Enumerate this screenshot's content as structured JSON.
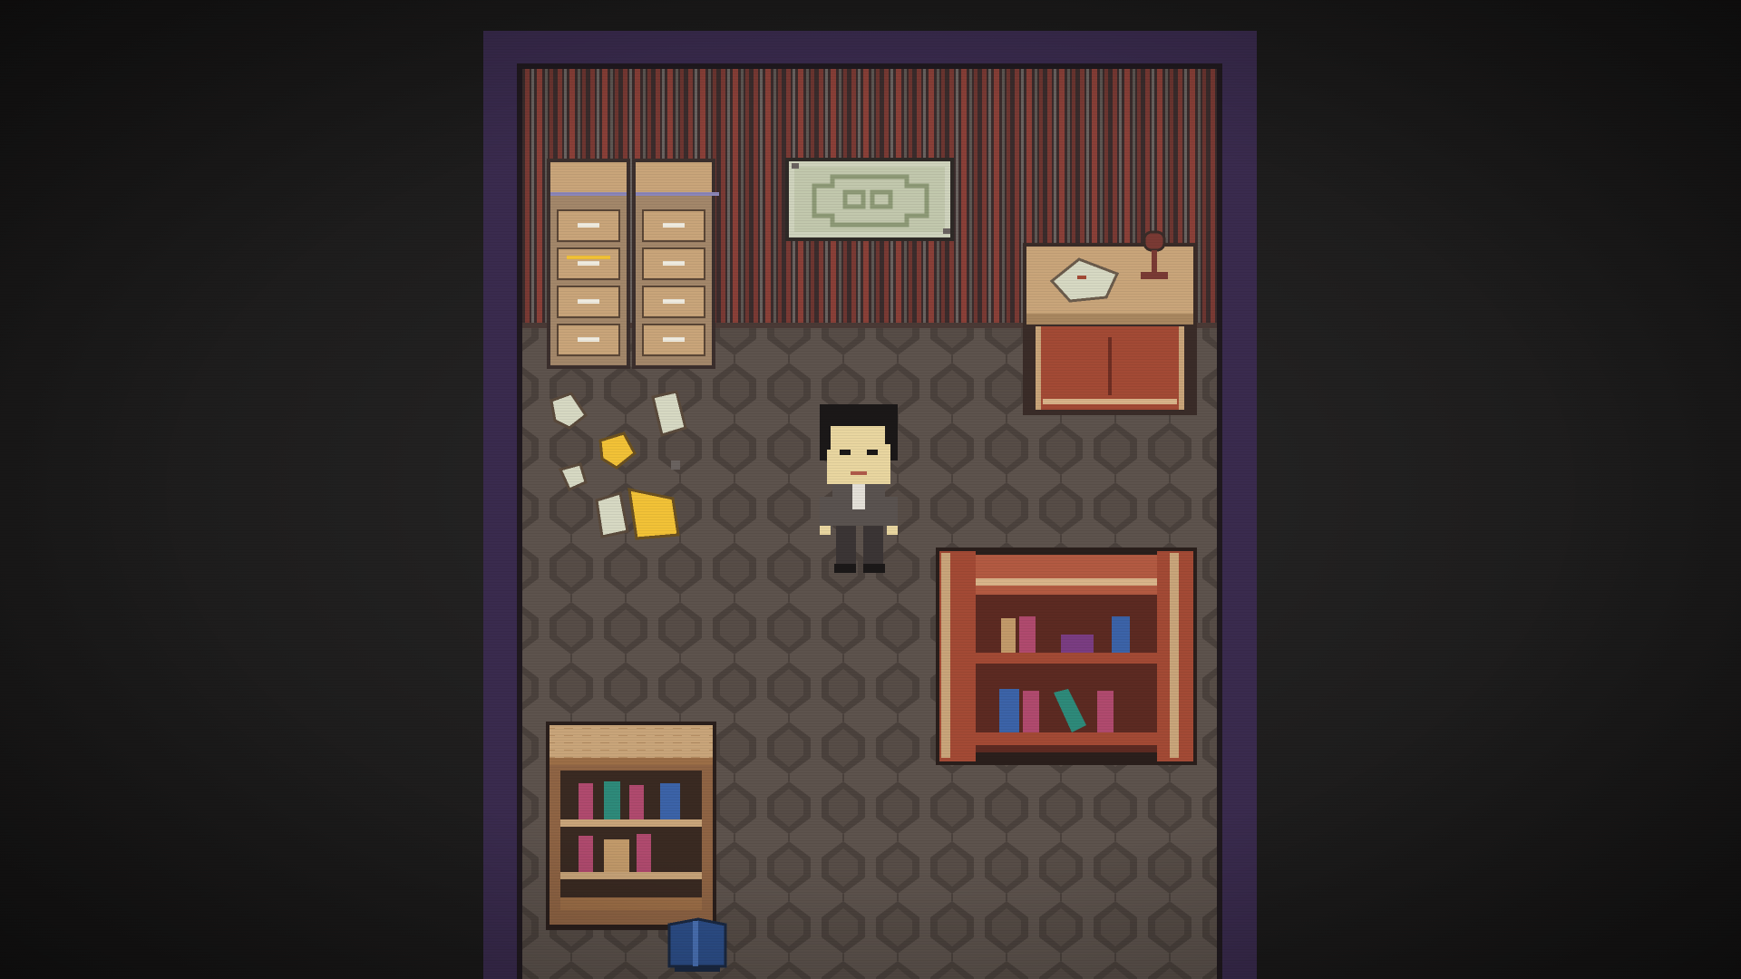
{
  "scene": {
    "name": "office-room",
    "palette": {
      "background": "#1c1b1b",
      "room_border_outer": "#3a2b4e",
      "room_border_inner": "#2a2233",
      "wall_stripe_dark": "#3b2c2c",
      "wall_stripe_red": "#7a3a34",
      "wall_stripe_gray": "#6a6360",
      "floor_base": "#5b514b",
      "floor_pattern": "#4a403b",
      "wood_light": "#c9a57a",
      "wood_mid": "#9c6e47",
      "wood_red": "#a34a35",
      "paper": "#d7d9c3",
      "gold": "#f2c237",
      "book_pink": "#b04a6e",
      "book_blue": "#3c63a8",
      "book_teal": "#2e8a7a",
      "book_tan": "#c29a6a",
      "book_purple": "#7a3d82"
    },
    "objects": [
      {
        "name": "filing-cabinet-left",
        "icon": "filing-cabinet-icon"
      },
      {
        "name": "filing-cabinet-right",
        "icon": "filing-cabinet-icon"
      },
      {
        "name": "wall-map",
        "icon": "map-icon"
      },
      {
        "name": "desk-with-lamp",
        "icon": "desk-icon"
      },
      {
        "name": "scattered-papers",
        "icon": "papers-icon"
      },
      {
        "name": "player-character",
        "icon": "person-icon"
      },
      {
        "name": "bookshelf-right",
        "icon": "bookshelf-icon"
      },
      {
        "name": "bookshelf-small",
        "icon": "bookshelf-icon"
      },
      {
        "name": "door-mat",
        "icon": "exit-icon"
      }
    ]
  }
}
